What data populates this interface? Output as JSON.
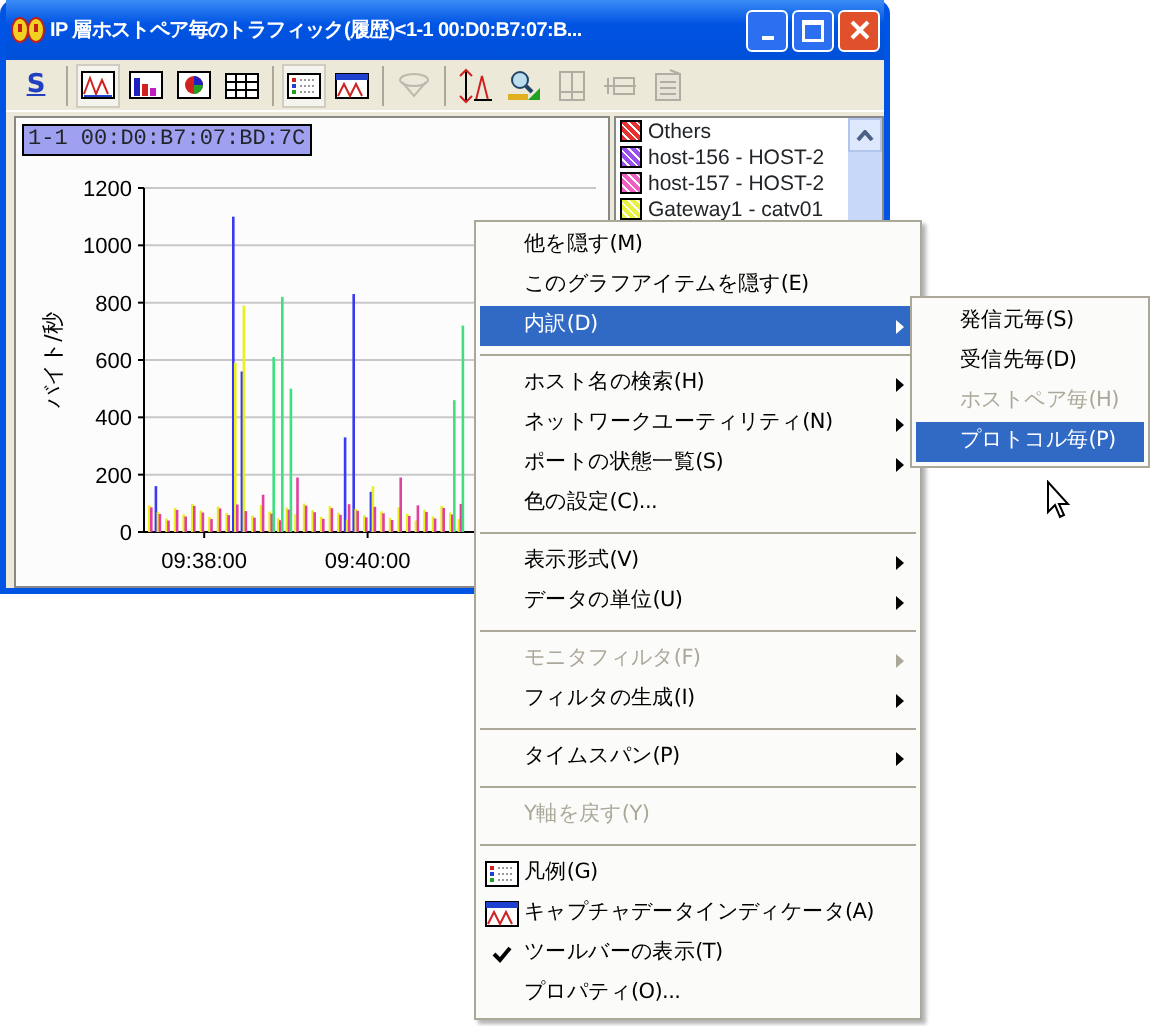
{
  "window": {
    "title": "IP 層ホストペア毎のトラフィック(履歴)<1-1 00:D0:B7:07:B..."
  },
  "toolbar": [
    {
      "kind": "s",
      "label": "S",
      "disabled": false
    },
    {
      "kind": "sep"
    },
    {
      "kind": "line",
      "selected": true,
      "disabled": false
    },
    {
      "kind": "bar",
      "selected": false,
      "disabled": false
    },
    {
      "kind": "pie",
      "selected": false,
      "disabled": false
    },
    {
      "kind": "table",
      "selected": false,
      "disabled": false
    },
    {
      "kind": "sep"
    },
    {
      "kind": "legend",
      "selected": true,
      "disabled": false
    },
    {
      "kind": "indicator",
      "selected": false,
      "disabled": false
    },
    {
      "kind": "sep"
    },
    {
      "kind": "filter",
      "disabled": true
    },
    {
      "kind": "sep"
    },
    {
      "kind": "axis",
      "disabled": false
    },
    {
      "kind": "search",
      "disabled": false
    },
    {
      "kind": "split",
      "disabled": true
    },
    {
      "kind": "ruler",
      "disabled": true
    },
    {
      "kind": "doc",
      "disabled": true
    }
  ],
  "chart_label": "1-1 00:D0:B7:07:BD:7C",
  "chart": {
    "ylabel": "バイト/秒",
    "y_ticks": [
      "1200",
      "1000",
      "800",
      "600",
      "400",
      "200",
      "0"
    ],
    "x_labels": [
      "09:38:00",
      "09:40:00"
    ]
  },
  "legend": [
    {
      "label": "Others",
      "color": "#e83030"
    },
    {
      "label": "host-156 - HOST-2",
      "color": "#9a50f0"
    },
    {
      "label": "host-157 - HOST-2",
      "color": "#f060c0"
    },
    {
      "label": "Gateway1 - catv01",
      "color": "#e8f040"
    }
  ],
  "context_menu": [
    {
      "kind": "item",
      "label": "他を隠す(M)",
      "selected": false,
      "disabled": false,
      "submenu": false
    },
    {
      "kind": "item",
      "label": "このグラフアイテムを隠す(E)",
      "selected": false,
      "disabled": false,
      "submenu": false
    },
    {
      "kind": "item",
      "label": "内訳(D)",
      "selected": true,
      "disabled": false,
      "submenu": true
    },
    {
      "kind": "sep"
    },
    {
      "kind": "item",
      "label": "ホスト名の検索(H)",
      "selected": false,
      "disabled": false,
      "submenu": true
    },
    {
      "kind": "item",
      "label": "ネットワークユーティリティ(N)",
      "selected": false,
      "disabled": false,
      "submenu": true
    },
    {
      "kind": "item",
      "label": "ポートの状態一覧(S)",
      "selected": false,
      "disabled": false,
      "submenu": true
    },
    {
      "kind": "item",
      "label": "色の設定(C)...",
      "selected": false,
      "disabled": false,
      "submenu": false
    },
    {
      "kind": "sep"
    },
    {
      "kind": "item",
      "label": "表示形式(V)",
      "selected": false,
      "disabled": false,
      "submenu": true
    },
    {
      "kind": "item",
      "label": "データの単位(U)",
      "selected": false,
      "disabled": false,
      "submenu": true
    },
    {
      "kind": "sep"
    },
    {
      "kind": "item",
      "label": "モニタフィルタ(F)",
      "selected": false,
      "disabled": true,
      "submenu": true
    },
    {
      "kind": "item",
      "label": "フィルタの生成(I)",
      "selected": false,
      "disabled": false,
      "submenu": true
    },
    {
      "kind": "sep"
    },
    {
      "kind": "item",
      "label": "タイムスパン(P)",
      "selected": false,
      "disabled": false,
      "submenu": true
    },
    {
      "kind": "sep"
    },
    {
      "kind": "item",
      "label": "Y軸を戻す(Y)",
      "selected": false,
      "disabled": true,
      "submenu": false
    },
    {
      "kind": "sep"
    },
    {
      "kind": "legend",
      "label": "凡例(G)",
      "selected": false,
      "disabled": false,
      "submenu": false
    },
    {
      "kind": "indicator",
      "label": "キャプチャデータインディケータ(A)",
      "selected": false,
      "disabled": false,
      "submenu": false
    },
    {
      "kind": "check",
      "label": "ツールバーの表示(T)",
      "checked": true,
      "selected": false,
      "disabled": false,
      "submenu": false
    },
    {
      "kind": "item",
      "label": "プロパティ(O)...",
      "selected": false,
      "disabled": false,
      "submenu": false
    }
  ],
  "submenu": [
    {
      "label": "発信元毎(S)",
      "selected": false,
      "disabled": false
    },
    {
      "label": "受信先毎(D)",
      "selected": false,
      "disabled": false
    },
    {
      "label": "ホストペア毎(H)",
      "selected": false,
      "disabled": true
    },
    {
      "label": "プロトコル毎(P)",
      "selected": true,
      "disabled": false
    }
  ]
}
